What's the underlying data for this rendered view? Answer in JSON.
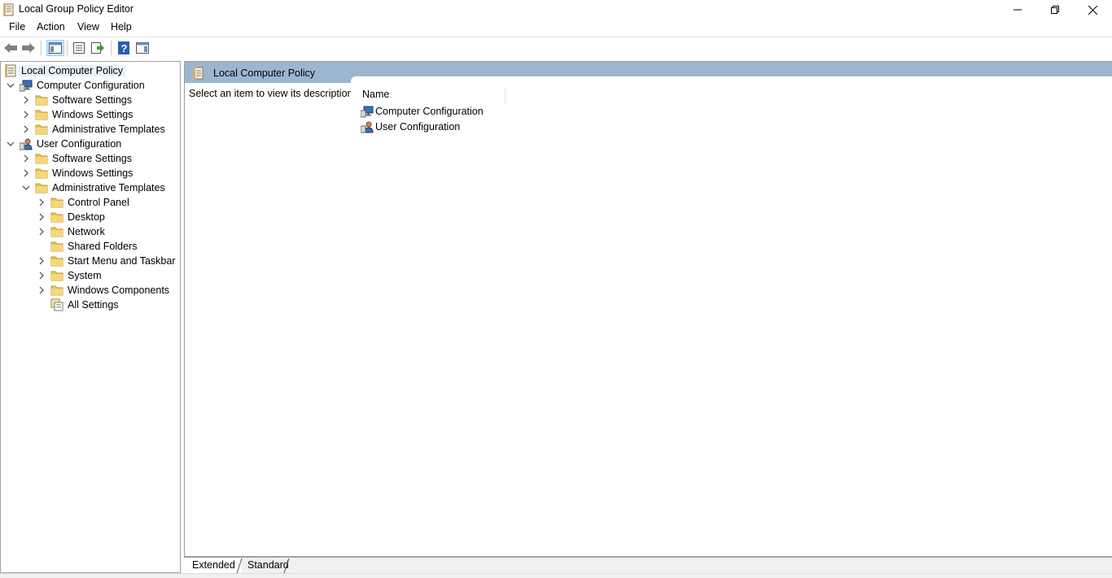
{
  "window": {
    "title": "Local Group Policy Editor"
  },
  "menu": [
    "File",
    "Action",
    "View",
    "Help"
  ],
  "toolbar": {
    "buttons": [
      "back-icon",
      "forward-icon",
      "show-hide-console-tree-icon",
      "properties-icon",
      "export-list-icon",
      "help-icon",
      "show-hide-action-pane-icon"
    ]
  },
  "tree": {
    "root": "Local Computer Policy",
    "items": [
      {
        "label": "Computer Configuration",
        "level": 1,
        "expanded": true,
        "icon": "computer-config-icon"
      },
      {
        "label": "Software Settings",
        "level": 2,
        "expanded": false,
        "icon": "folder-icon"
      },
      {
        "label": "Windows Settings",
        "level": 2,
        "expanded": false,
        "icon": "folder-icon"
      },
      {
        "label": "Administrative Templates",
        "level": 2,
        "expanded": false,
        "icon": "folder-icon"
      },
      {
        "label": "User Configuration",
        "level": 1,
        "expanded": true,
        "icon": "user-config-icon"
      },
      {
        "label": "Software Settings",
        "level": 2,
        "expanded": false,
        "icon": "folder-icon"
      },
      {
        "label": "Windows Settings",
        "level": 2,
        "expanded": false,
        "icon": "folder-icon"
      },
      {
        "label": "Administrative Templates",
        "level": 2,
        "expanded": true,
        "icon": "folder-icon"
      },
      {
        "label": "Control Panel",
        "level": 3,
        "expanded": false,
        "icon": "folder-icon"
      },
      {
        "label": "Desktop",
        "level": 3,
        "expanded": false,
        "icon": "folder-icon"
      },
      {
        "label": "Network",
        "level": 3,
        "expanded": false,
        "icon": "folder-icon"
      },
      {
        "label": "Shared Folders",
        "level": 3,
        "expanded": null,
        "icon": "folder-icon"
      },
      {
        "label": "Start Menu and Taskbar",
        "level": 3,
        "expanded": false,
        "icon": "folder-icon"
      },
      {
        "label": "System",
        "level": 3,
        "expanded": false,
        "icon": "folder-icon"
      },
      {
        "label": "Windows Components",
        "level": 3,
        "expanded": false,
        "icon": "folder-icon"
      },
      {
        "label": "All Settings",
        "level": 3,
        "expanded": null,
        "icon": "all-settings-icon"
      }
    ]
  },
  "main": {
    "header": "Local Computer Policy",
    "description": "Select an item to view its description.",
    "column_name": "Name",
    "items": [
      {
        "label": "Computer Configuration",
        "icon": "computer-config-icon"
      },
      {
        "label": "User Configuration",
        "icon": "user-config-icon"
      }
    ]
  },
  "tabs": [
    "Extended",
    "Standard"
  ],
  "colors": {
    "header_bg": "#9db6d0",
    "selection": "#e5f3ff",
    "folder": "#e8c35a"
  }
}
